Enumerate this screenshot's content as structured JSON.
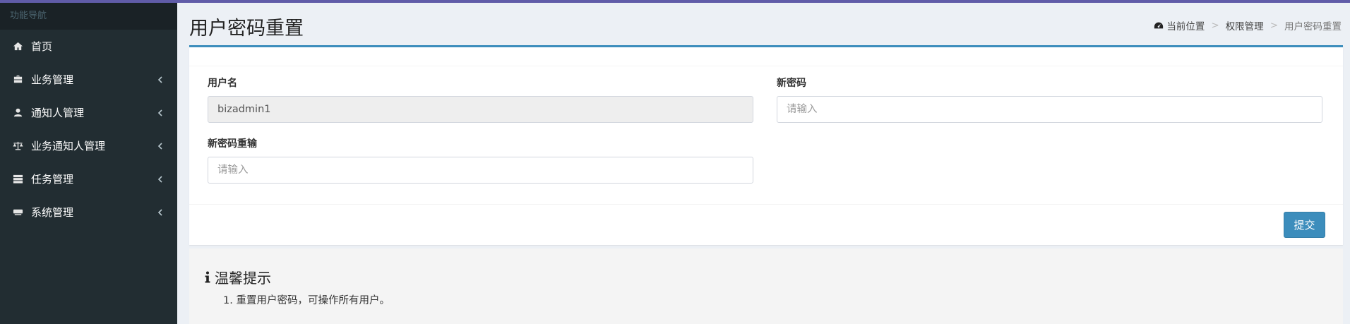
{
  "sidebar": {
    "header": "功能导航",
    "items": [
      {
        "label": "首页",
        "icon": "home-icon",
        "has_children": false
      },
      {
        "label": "业务管理",
        "icon": "briefcase-icon",
        "has_children": true
      },
      {
        "label": "通知人管理",
        "icon": "user-icon",
        "has_children": true
      },
      {
        "label": "业务通知人管理",
        "icon": "balance-scale-icon",
        "has_children": true
      },
      {
        "label": "任务管理",
        "icon": "server-icon",
        "has_children": true
      },
      {
        "label": "系统管理",
        "icon": "keyboard-icon",
        "has_children": true
      }
    ]
  },
  "header": {
    "title": "用户密码重置",
    "breadcrumb": {
      "icon": "dashboard-icon",
      "items": [
        "当前位置",
        "权限管理",
        "用户密码重置"
      ],
      "separator": ">"
    }
  },
  "form": {
    "username": {
      "label": "用户名",
      "value": "bizadmin1",
      "disabled": true
    },
    "new_password": {
      "label": "新密码",
      "value": "",
      "placeholder": "请输入"
    },
    "confirm_password": {
      "label": "新密码重输",
      "value": "",
      "placeholder": "请输入"
    },
    "submit_label": "提交"
  },
  "tips": {
    "title": "温馨提示",
    "icon": "info-icon",
    "items": [
      "1. 重置用户密码，可操作所有用户。"
    ]
  },
  "colors": {
    "topbar": "#605ca8",
    "sidebar_bg": "#222d32",
    "accent": "#3c8dbc",
    "content_bg": "#ecf0f5"
  }
}
